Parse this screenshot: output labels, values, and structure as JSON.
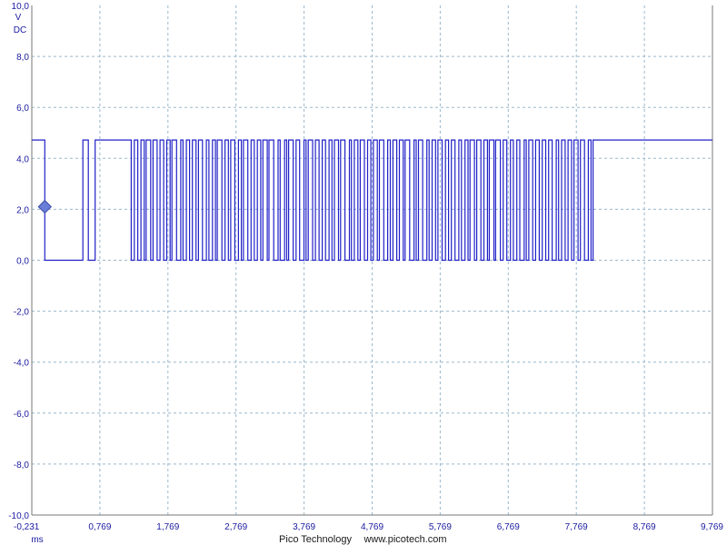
{
  "chart_data": {
    "type": "line",
    "title": "",
    "ylabel": "V",
    "coupling": "DC",
    "xunit": "ms",
    "ylim": [
      -10.0,
      10.0
    ],
    "xlim": [
      -0.231,
      9.769
    ],
    "grid": true,
    "y_ticks": [
      "-10,0",
      "-8,0",
      "-6,0",
      "-4,0",
      "-2,0",
      "0,0",
      "2,0",
      "4,0",
      "6,0",
      "8,0",
      "10,0"
    ],
    "x_ticks": [
      "-0,231",
      "0,769",
      "1,769",
      "2,769",
      "3,769",
      "4,769",
      "5,769",
      "6,769",
      "7,769",
      "8,769",
      "9,769"
    ],
    "trigger_marker": {
      "x": -0.04,
      "y": 2.1
    },
    "series": [
      {
        "color": "#2020c8",
        "high": 4.72,
        "low": 0.0,
        "idle_start": -0.231,
        "idle_end": 9.769,
        "first_low": [
          -0.04,
          0.52
        ],
        "high_windows": [
          [
            0.52,
            0.6
          ],
          [
            0.7,
            1.15
          ]
        ],
        "data_start": 1.23,
        "data_end": 8.08,
        "pulse_count": 72,
        "end_high": 8.1
      }
    ]
  },
  "footer": {
    "brand": "Pico Technology",
    "url": "www.picotech.com"
  },
  "colors": {
    "trace": "#2020c8",
    "grid": "#9ab8cc",
    "labels": "#1a1aa0",
    "marker": "#6a7fd8"
  }
}
